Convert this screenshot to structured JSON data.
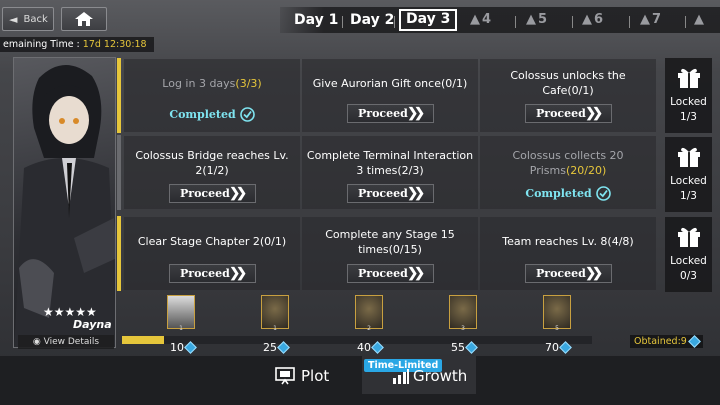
{
  "nav": {
    "back_label": "Back"
  },
  "tabs": [
    {
      "label": "Day 1",
      "state": "normal"
    },
    {
      "label": "Day 2",
      "state": "normal"
    },
    {
      "label": "Day 3",
      "state": "active"
    },
    {
      "label": "4",
      "state": "locked"
    },
    {
      "label": "5",
      "state": "locked"
    },
    {
      "label": "6",
      "state": "locked"
    },
    {
      "label": "7",
      "state": "locked"
    }
  ],
  "timer": {
    "label": "emaining Time :",
    "value": "17d 12:30:18"
  },
  "character": {
    "name": "Dayna",
    "stars": "★★★★★",
    "view_details": "View Details"
  },
  "rows": [
    {
      "tasks": [
        {
          "text": "Log in 3 days",
          "count": "(3/3)",
          "status": "Completed",
          "done": true
        },
        {
          "text": "Give Aurorian Gift once(0/1)",
          "status": "Proceed",
          "done": false
        },
        {
          "text": "Colossus unlocks the Cafe(0/1)",
          "status": "Proceed",
          "done": false
        }
      ],
      "reward": {
        "state": "Locked",
        "count": "1/3"
      }
    },
    {
      "tasks": [
        {
          "text": "Colossus Bridge reaches Lv. 2(1/2)",
          "status": "Proceed",
          "done": false
        },
        {
          "text": "Complete Terminal Interaction 3 times(2/3)",
          "status": "Proceed",
          "done": false
        },
        {
          "text": "Colossus collects 20 Prisms",
          "count": "(20/20)",
          "status": "Completed",
          "done": true
        }
      ],
      "reward": {
        "state": "Locked",
        "count": "1/3"
      }
    },
    {
      "tasks": [
        {
          "text": "Clear Stage Chapter 2(0/1)",
          "status": "Proceed",
          "done": false
        },
        {
          "text": "Complete any Stage 15 times(0/15)",
          "status": "Proceed",
          "done": false
        },
        {
          "text": "Team reaches Lv. 8(4/8)",
          "status": "Proceed",
          "done": false
        }
      ],
      "reward": {
        "state": "Locked",
        "count": "0/3"
      }
    }
  ],
  "milestones": [
    {
      "value": "10",
      "level": "1"
    },
    {
      "value": "25",
      "level": "1"
    },
    {
      "value": "40",
      "level": "2"
    },
    {
      "value": "55",
      "level": "3"
    },
    {
      "value": "70",
      "level": "5"
    }
  ],
  "progress_fraction": 0.09,
  "obtained": {
    "label": "Obtained:9"
  },
  "bottom_tabs": {
    "plot": "Plot",
    "growth": "Growth",
    "badge": "Time-Limited"
  },
  "colors": {
    "accent": "#e6c63b",
    "completed": "#7fe4f0",
    "badge": "#2aa7e5"
  }
}
